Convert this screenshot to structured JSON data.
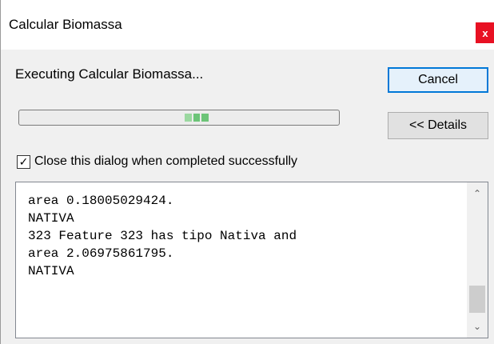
{
  "window": {
    "title": "Calcular Biomassa",
    "close_glyph": "x"
  },
  "status": {
    "text": "Executing Calcular Biomassa..."
  },
  "buttons": {
    "cancel": "Cancel",
    "details": "<< Details"
  },
  "progress": {
    "style": "marquee-indeterminate",
    "accent_color": "#6cc478"
  },
  "checkbox": {
    "checked": true,
    "glyph": "✓",
    "label": "Close this dialog when completed successfully"
  },
  "log": {
    "lines": [
      "area 0.18005029424.",
      "NATIVA",
      "323 Feature 323 has tipo Nativa and",
      "area 2.06975861795.",
      "NATIVA"
    ]
  },
  "scrollbar": {
    "up_glyph": "⌃",
    "down_glyph": "⌄",
    "position_fraction": 0.85
  },
  "colors": {
    "close_red": "#e81123",
    "focus_blue": "#0078d7"
  }
}
